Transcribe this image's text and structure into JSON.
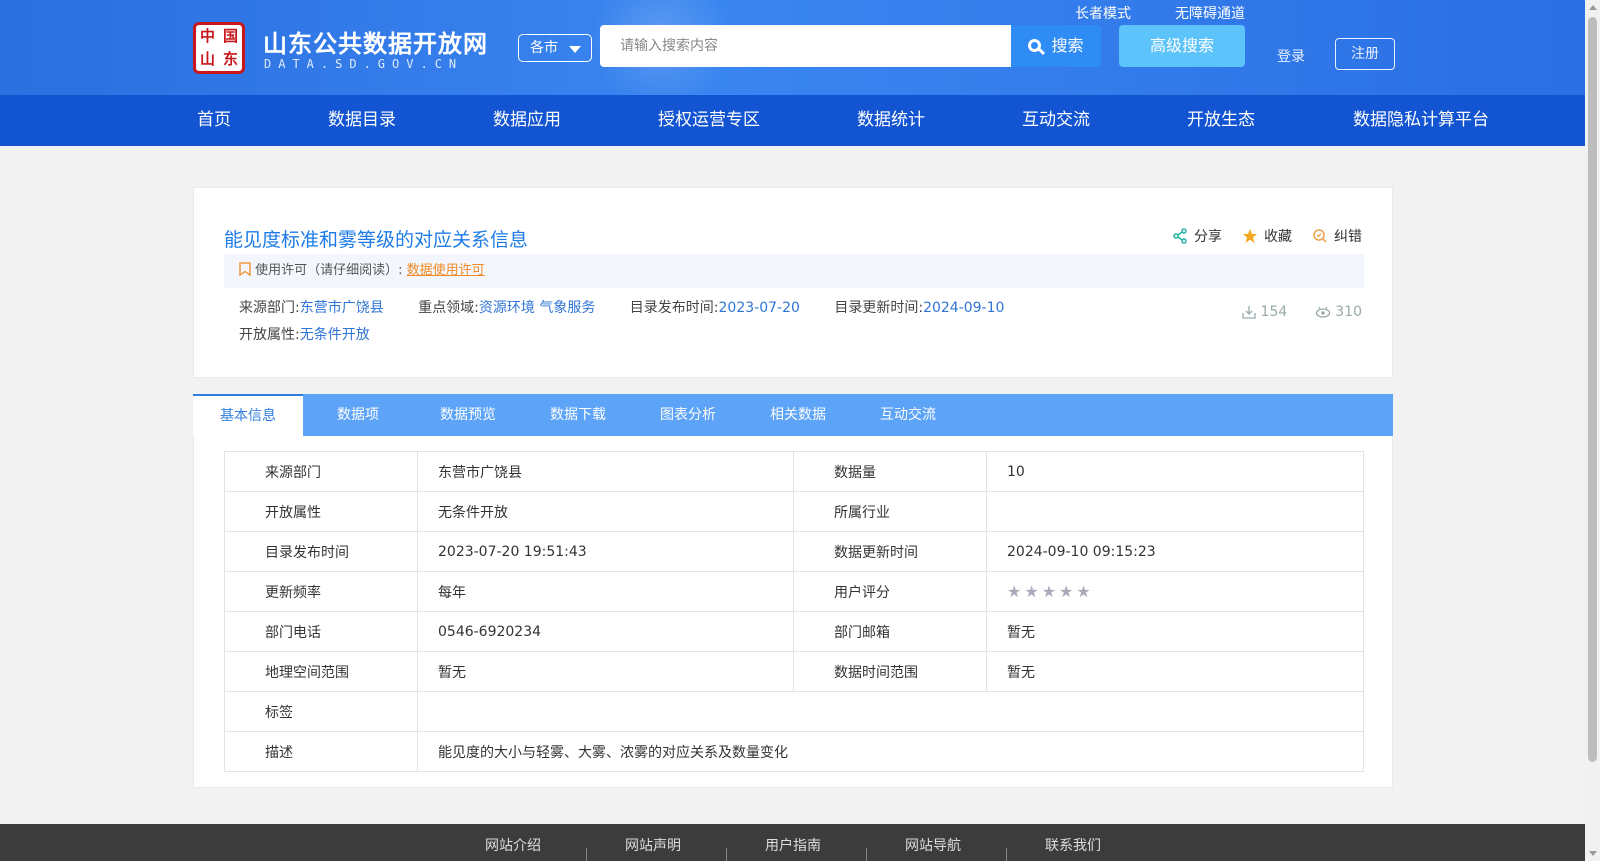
{
  "header": {
    "seal_chars": [
      "中",
      "国",
      "山",
      "东"
    ],
    "site_title": "山东公共数据开放网",
    "site_domain": "DATA.SD.GOV.CN",
    "city_select": "各市",
    "search_placeholder": "请输入搜索内容",
    "search_button": "搜索",
    "advanced_search": "高级搜索",
    "elder_mode": "长者模式",
    "accessibility": "无障碍通道",
    "login": "登录",
    "register": "注册"
  },
  "nav": [
    "首页",
    "数据目录",
    "数据应用",
    "授权运营专区",
    "数据统计",
    "互动交流",
    "开放生态",
    "数据隐私计算平台"
  ],
  "detail": {
    "title": "能见度标准和雾等级的对应关系信息",
    "actions": {
      "share": "分享",
      "favorite": "收藏",
      "correct": "纠错"
    },
    "license_label": "使用许可（请仔细阅读）:",
    "license_link": "数据使用许可",
    "meta": {
      "source_label": "来源部门:",
      "source_value": "东营市广饶县",
      "domain_label": "重点领域:",
      "domain_value": "资源环境 气象服务",
      "publish_label": "目录发布时间:",
      "publish_value": "2023-07-20",
      "update_label": "目录更新时间:",
      "update_value": "2024-09-10",
      "open_label": "开放属性:",
      "open_value": "无条件开放"
    },
    "stats": {
      "downloads": "154",
      "views": "310"
    }
  },
  "tabs": [
    "基本信息",
    "数据项",
    "数据预览",
    "数据下载",
    "图表分析",
    "相关数据",
    "互动交流"
  ],
  "info_table": {
    "rows": [
      {
        "k1": "来源部门",
        "v1": "东营市广饶县",
        "k2": "数据量",
        "v2": "10"
      },
      {
        "k1": "开放属性",
        "v1": "无条件开放",
        "k2": "所属行业",
        "v2": ""
      },
      {
        "k1": "目录发布时间",
        "v1": "2023-07-20 19:51:43",
        "k2": "数据更新时间",
        "v2": "2024-09-10 09:15:23"
      },
      {
        "k1": "更新频率",
        "v1": "每年",
        "k2": "用户评分",
        "v2": ""
      },
      {
        "k1": "部门电话",
        "v1": "0546-6920234",
        "k2": "部门邮箱",
        "v2": "暂无"
      },
      {
        "k1": "地理空间范围",
        "v1": "暂无",
        "k2": "数据时间范围",
        "v2": "暂无"
      }
    ],
    "tags_label": "标签",
    "tags_value": "",
    "desc_label": "描述",
    "desc_value": "能见度的大小与轻雾、大雾、浓雾的对应关系及数量变化",
    "rating_stars": 0
  },
  "footer": [
    "网站介绍",
    "网站声明",
    "用户指南",
    "网站导航",
    "联系我们"
  ],
  "colors": {
    "nav_bg": "#1254d1",
    "tab_bg": "#5da3f7",
    "title_blue": "#1e7ce8",
    "license_orange": "#f08a24"
  }
}
